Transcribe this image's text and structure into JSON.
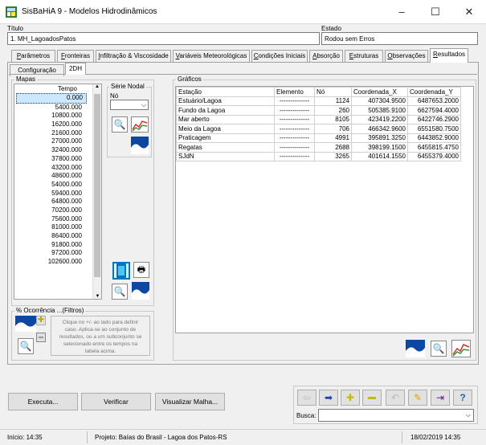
{
  "window": {
    "title": "SisBaHiA 9 - Modelos Hidrodinâmicos",
    "minimize": "–",
    "maximize": "☐",
    "close": "✕"
  },
  "titulo": {
    "label": "Título",
    "value": "1. MH_LagoadosPatos"
  },
  "estado": {
    "label": "Estado",
    "value": "Rodou sem Erros"
  },
  "tabs": [
    {
      "pre": "",
      "key": "P",
      "post": "arâmetros"
    },
    {
      "pre": "",
      "key": "F",
      "post": "ronteiras"
    },
    {
      "pre": "",
      "key": "I",
      "post": "nfiltração & Viscosidade"
    },
    {
      "pre": "",
      "key": "V",
      "post": "ariáveis Meteorológicas"
    },
    {
      "pre": "",
      "key": "C",
      "post": "ondições Iniciais"
    },
    {
      "pre": "",
      "key": "A",
      "post": "bsorção"
    },
    {
      "pre": "",
      "key": "E",
      "post": "struturas"
    },
    {
      "pre": "",
      "key": "O",
      "post": "bservações"
    },
    {
      "pre": "",
      "key": "R",
      "post": "esultados"
    }
  ],
  "subtabs": {
    "configuracao": "Configuração",
    "twodh": "2DH"
  },
  "mapas": {
    "legend": "Mapas",
    "header": "Tempo",
    "times": [
      "0.000",
      "5400.000",
      "10800.000",
      "16200.000",
      "21600.000",
      "27000.000",
      "32400.000",
      "37800.000",
      "43200.000",
      "48600.000",
      "54000.000",
      "59400.000",
      "64800.000",
      "70200.000",
      "75600.000",
      "81000.000",
      "86400.000",
      "91800.000",
      "97200.000",
      "102600.000"
    ]
  },
  "serie_nodal": {
    "legend": "Série Nodal",
    "no_label": "Nó"
  },
  "ocorrencia": {
    "legend": "% Ocorrência ...(Filtros)",
    "hint": [
      "Clique no +/- ao lado para definir",
      "caso. Aplica-se ao conjunto de",
      "resultados, ou a um subconjunto se",
      "selecionado entre os tempos na",
      "tabela acima."
    ]
  },
  "graficos": {
    "legend": "Gráficos",
    "columns": [
      "Estação",
      "Elemento",
      "Nó",
      "Coordenada_X",
      "Coordenada_Y"
    ],
    "rows": [
      [
        "Estuário/Lagoa",
        "--------------",
        "1124",
        "407304.9500",
        "6487653.2000"
      ],
      [
        "Fundo da Lagoa",
        "--------------",
        "260",
        "505385.9100",
        "6627594.4000"
      ],
      [
        "Mar aberto",
        "--------------",
        "8105",
        "423419.2200",
        "6422746.2900"
      ],
      [
        "Meio da Lagoa",
        "--------------",
        "706",
        "466342.9600",
        "6551580.7500"
      ],
      [
        "Praticagem",
        "--------------",
        "4991",
        "395891.3250",
        "6443852.9000"
      ],
      [
        "Regatas",
        "--------------",
        "2688",
        "398199.1500",
        "6455815.4750"
      ],
      [
        "SJdN",
        "--------------",
        "3265",
        "401614.1550",
        "6455379.4000"
      ]
    ]
  },
  "buttons": {
    "executa": "Executa...",
    "verificar": "Verificar",
    "visualizar": "Visualizar Malha..."
  },
  "busca": {
    "label": "Busca:",
    "value": ""
  },
  "status": {
    "inicio": "Início: 14:35",
    "projeto": "Projeto: Baías do Brasil - Lagoa dos Patos-RS",
    "data": "18/02/2019 14:35"
  }
}
